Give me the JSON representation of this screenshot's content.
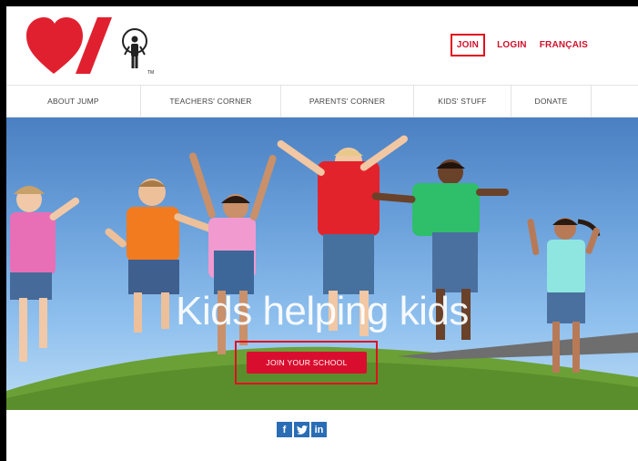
{
  "header": {
    "logo_label": "Jump Rope for Heart logo",
    "links": {
      "join": "JOIN",
      "login": "LOGIN",
      "francais": "FRANÇAIS"
    }
  },
  "nav": {
    "items": [
      {
        "label": "ABOUT JUMP"
      },
      {
        "label": "TEACHERS' CORNER"
      },
      {
        "label": "PARENTS' CORNER"
      },
      {
        "label": "KIDS' STUFF"
      },
      {
        "label": "DONATE"
      }
    ]
  },
  "hero": {
    "title": "Kids helping kids",
    "cta_label": "JOIN YOUR SCHOOL"
  },
  "social": {
    "facebook": "f",
    "twitter": "t",
    "linkedin": "in"
  },
  "colors": {
    "brand_red": "#d90e2e",
    "nav_text": "#444444",
    "social_blue": "#2a6db5",
    "highlight_box": "#e0101e"
  }
}
